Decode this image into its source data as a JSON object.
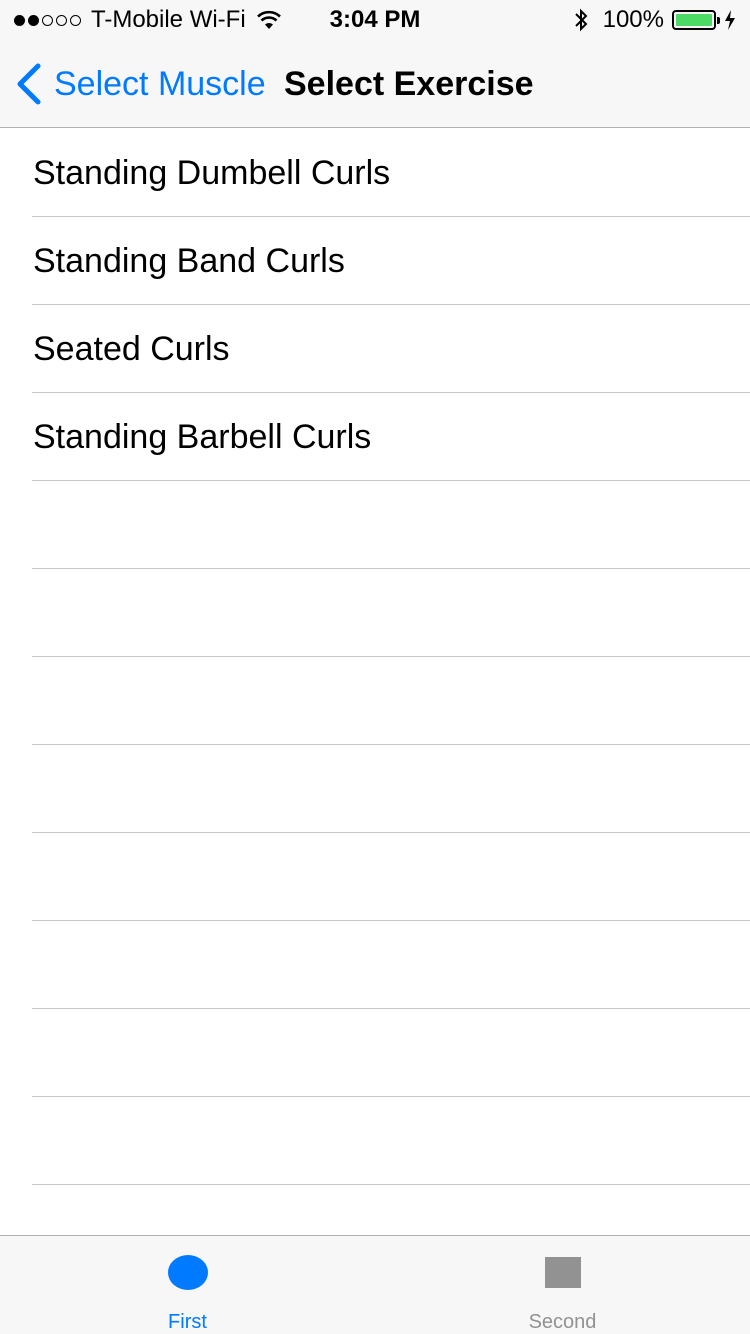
{
  "status_bar": {
    "signal_bars_filled": 2,
    "signal_bars_total": 5,
    "carrier": "T-Mobile Wi-Fi",
    "time": "3:04 PM",
    "battery_percent": "100%",
    "battery_level": 1.0,
    "battery_color": "#4cd964"
  },
  "nav": {
    "back_label": "Select Muscle",
    "title": "Select Exercise",
    "accent_color": "#007aff"
  },
  "exercises": [
    {
      "label": "Standing Dumbell Curls"
    },
    {
      "label": "Standing Band Curls"
    },
    {
      "label": "Seated Curls"
    },
    {
      "label": "Standing Barbell Curls"
    },
    {
      "label": ""
    },
    {
      "label": ""
    },
    {
      "label": ""
    },
    {
      "label": ""
    },
    {
      "label": ""
    },
    {
      "label": ""
    },
    {
      "label": ""
    },
    {
      "label": ""
    },
    {
      "label": ""
    }
  ],
  "tab_bar": {
    "tabs": [
      {
        "label": "First",
        "icon": "circle-icon",
        "selected": true
      },
      {
        "label": "Second",
        "icon": "square-icon",
        "selected": false
      }
    ]
  }
}
